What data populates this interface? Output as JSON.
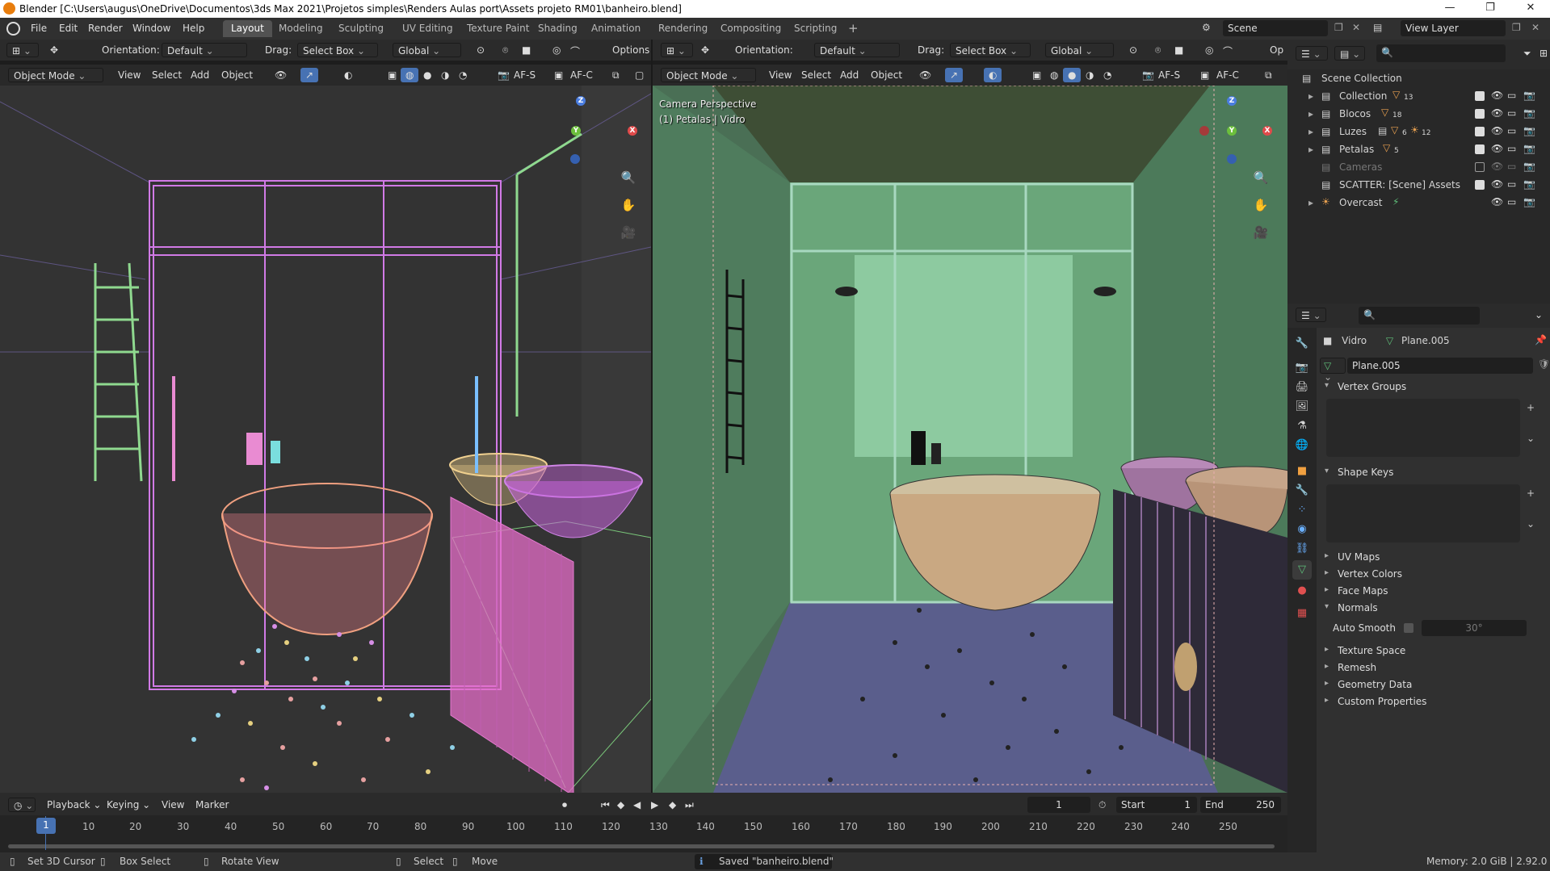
{
  "title_bar": {
    "title": "Blender [C:\\Users\\augus\\OneDrive\\Documentos\\3ds Max 2021\\Projetos simples\\Renders Aulas port\\Assets projeto RM01\\banheiro.blend]",
    "min": "—",
    "max": "❐",
    "close": "✕"
  },
  "menus": [
    "File",
    "Edit",
    "Render",
    "Window",
    "Help"
  ],
  "workspaces": [
    "Layout",
    "Modeling",
    "Sculpting",
    "UV Editing",
    "Texture Paint",
    "Shading",
    "Animation",
    "Rendering",
    "Compositing",
    "Scripting"
  ],
  "add_workspace": "+",
  "scene": "Scene",
  "view_layer": "View Layer",
  "tool_header": {
    "orientation_label": "Orientation:",
    "orientation_value": "Default",
    "drag_label": "Drag:",
    "drag_value": "Select Box",
    "transform": "Global",
    "options": "Options",
    "options_short": "Op"
  },
  "viewport_header": {
    "mode": "Object Mode",
    "view": "View",
    "select": "Select",
    "add": "Add",
    "object": "Object",
    "afs": "AF-S",
    "afc": "AF-C"
  },
  "right_viewport": {
    "line1": "Camera Perspective",
    "line2": "(1) Petalas | Vidro"
  },
  "gizmo": {
    "x": "X",
    "y": "Y",
    "z": "Z"
  },
  "outliner": {
    "search_placeholder": "",
    "root": "Scene Collection",
    "items": [
      {
        "name": "Collection",
        "badge": "13"
      },
      {
        "name": "Blocos",
        "badge": "18"
      },
      {
        "name": "Luzes",
        "badge": "6",
        "badge2": "12"
      },
      {
        "name": "Petalas",
        "badge": "5"
      },
      {
        "name": "Cameras",
        "badge": ""
      },
      {
        "name": "SCATTER: [Scene] Assets",
        "badge": ""
      },
      {
        "name": "Overcast",
        "badge": ""
      }
    ]
  },
  "properties": {
    "object_name": "Vidro",
    "mesh_name": "Plane.005",
    "datablock": "Plane.005",
    "panels_open": [
      "Vertex Groups",
      "Shape Keys"
    ],
    "panels_closed": [
      "UV Maps",
      "Vertex Colors",
      "Face Maps"
    ],
    "normals": "Normals",
    "auto_smooth_label": "Auto Smooth",
    "auto_smooth_angle": "30°",
    "panels_bottom": [
      "Texture Space",
      "Remesh",
      "Geometry Data",
      "Custom Properties"
    ]
  },
  "timeline": {
    "playback": "Playback",
    "keying": "Keying",
    "view": "View",
    "marker": "Marker",
    "current_frame": "1",
    "start_label": "Start",
    "start": "1",
    "end_label": "End",
    "end": "250",
    "ticks": [
      "1",
      "10",
      "20",
      "30",
      "40",
      "50",
      "60",
      "70",
      "80",
      "90",
      "100",
      "110",
      "120",
      "130",
      "140",
      "150",
      "160",
      "170",
      "180",
      "190",
      "200",
      "210",
      "220",
      "230",
      "240",
      "250"
    ]
  },
  "status_bar": {
    "cursor": "Set 3D Cursor",
    "box_select": "Box Select",
    "rotate": "Rotate View",
    "select": "Select",
    "move": "Move",
    "message": "Saved \"banheiro.blend\"",
    "memory": "Memory: 2.0 GiB | 2.92.0"
  }
}
